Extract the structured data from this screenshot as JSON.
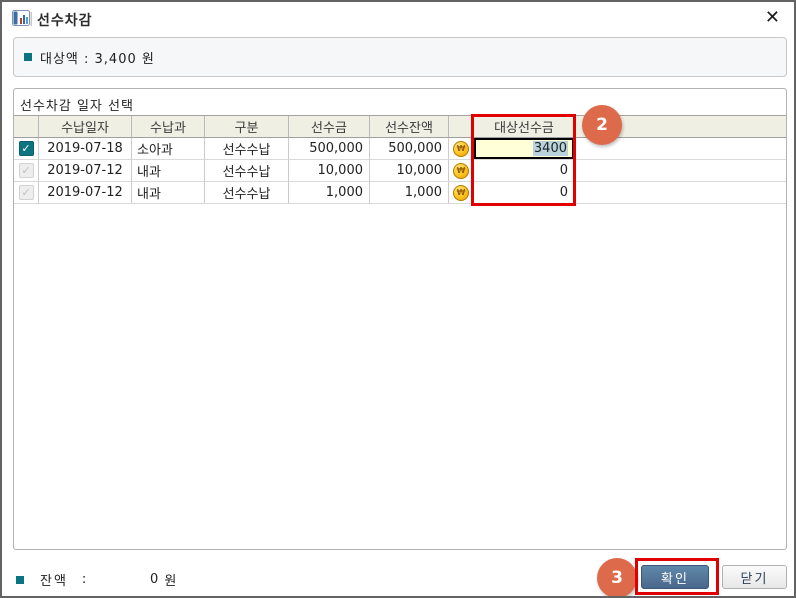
{
  "window": {
    "title": "선수차감"
  },
  "icons": {
    "close": "✕",
    "check": "✓",
    "coin": "₩"
  },
  "summary": {
    "text": "대상액  :  3,400 원"
  },
  "section": {
    "title": "선수차감 일자 선택"
  },
  "table": {
    "columns": [
      "",
      "수납일자",
      "수납과",
      "구분",
      "선수금",
      "선수잔액",
      "",
      "대상선수금",
      ""
    ],
    "rows": [
      {
        "checked": true,
        "date": "2019-07-18",
        "dept": "소아과",
        "type": "선수수납",
        "amount": "500,000",
        "balance": "500,000",
        "target": "3400"
      },
      {
        "checked": false,
        "date": "2019-07-12",
        "dept": "내과",
        "type": "선수수납",
        "amount": "10,000",
        "balance": "10,000",
        "target": "0"
      },
      {
        "checked": false,
        "date": "2019-07-12",
        "dept": "내과",
        "type": "선수수납",
        "amount": "1,000",
        "balance": "1,000",
        "target": "0"
      }
    ]
  },
  "footer": {
    "balance_label": "잔액",
    "balance_colon": ":",
    "balance_value": "0",
    "balance_unit": "원",
    "confirm_label": "확인",
    "close_label": "닫기"
  },
  "annotations": {
    "step2": "2",
    "step3": "3"
  },
  "colors": {
    "accent_teal": "#0a7580",
    "header_bg": "#f0efe4",
    "editor_bg": "#ffffd8",
    "annotation_red": "#e10000",
    "annotation_circle": "#dd6a4a",
    "confirm_btn": "#4f7396"
  }
}
